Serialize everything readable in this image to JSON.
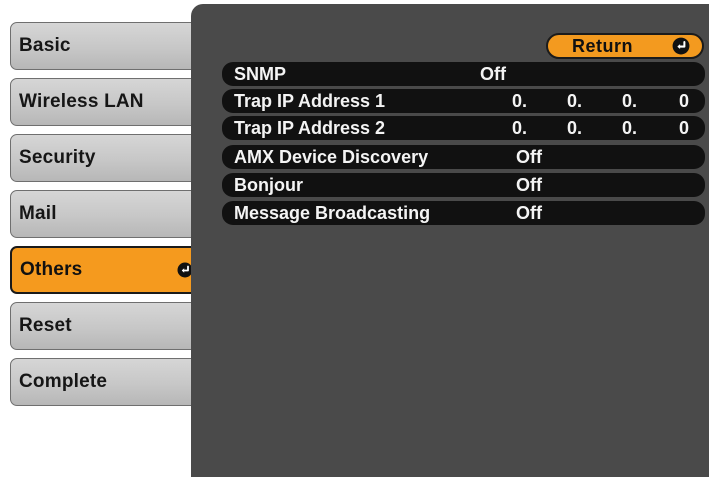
{
  "sidebar": {
    "items": [
      {
        "label": "Basic",
        "selected": false
      },
      {
        "label": "Wireless LAN",
        "selected": false
      },
      {
        "label": "Security",
        "selected": false
      },
      {
        "label": "Mail",
        "selected": false
      },
      {
        "label": "Others",
        "selected": true
      },
      {
        "label": "Reset",
        "selected": false
      },
      {
        "label": "Complete",
        "selected": false
      }
    ]
  },
  "return_button": {
    "label": "Return",
    "icon": "enter-icon"
  },
  "settings": {
    "snmp": {
      "label": "SNMP",
      "value": "Off"
    },
    "trap1": {
      "label": "Trap IP Address 1",
      "octets": [
        "0.",
        "0.",
        "0.",
        "0"
      ]
    },
    "trap2": {
      "label": "Trap IP Address 2",
      "octets": [
        "0.",
        "0.",
        "0.",
        "0"
      ]
    },
    "amx": {
      "label": "AMX Device Discovery",
      "value": "Off"
    },
    "bonjour": {
      "label": "Bonjour",
      "value": "Off"
    },
    "message": {
      "label": "Message Broadcasting",
      "value": "Off"
    }
  },
  "colors": {
    "accent": "#f59a1e",
    "panel": "#4a4a4a",
    "row": "#111111",
    "tab": "#c7c7c7"
  }
}
